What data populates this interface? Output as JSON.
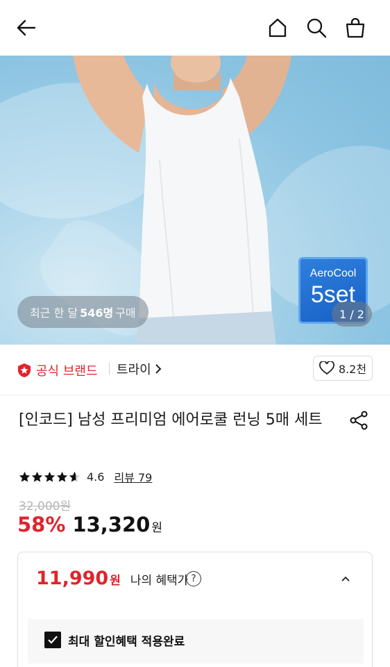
{
  "header": {
    "back_icon": "arrow-left-icon",
    "home_icon": "home-icon",
    "search_icon": "search-icon",
    "cart_icon": "shopping-bag-icon"
  },
  "hero": {
    "recent_prefix": "최근 한 달",
    "recent_count": "546명",
    "recent_suffix": "구매",
    "promo_line1": "AeroCool",
    "promo_line2": "5set",
    "pager": "1 / 2"
  },
  "brand": {
    "official_label": "공식 브랜드",
    "brand_name": "트라이",
    "like_count": "8.2천",
    "colors": {
      "accent": "#e0242d"
    }
  },
  "product": {
    "title": "[인코드] 남성 프리미엄 에어로쿨 런닝 5매 세트",
    "rating": "4.6",
    "review_label": "리뷰 79",
    "rating_stars": 4.6,
    "original_price": "32,000원",
    "discount_rate": "58%",
    "sale_price": "13,320",
    "currency": "원"
  },
  "benefit": {
    "price": "11,990",
    "currency": "원",
    "label": "나의 혜택가",
    "help_icon": "?",
    "applied_label": "최대 할인혜택 적용완료",
    "applied_checked": true
  }
}
